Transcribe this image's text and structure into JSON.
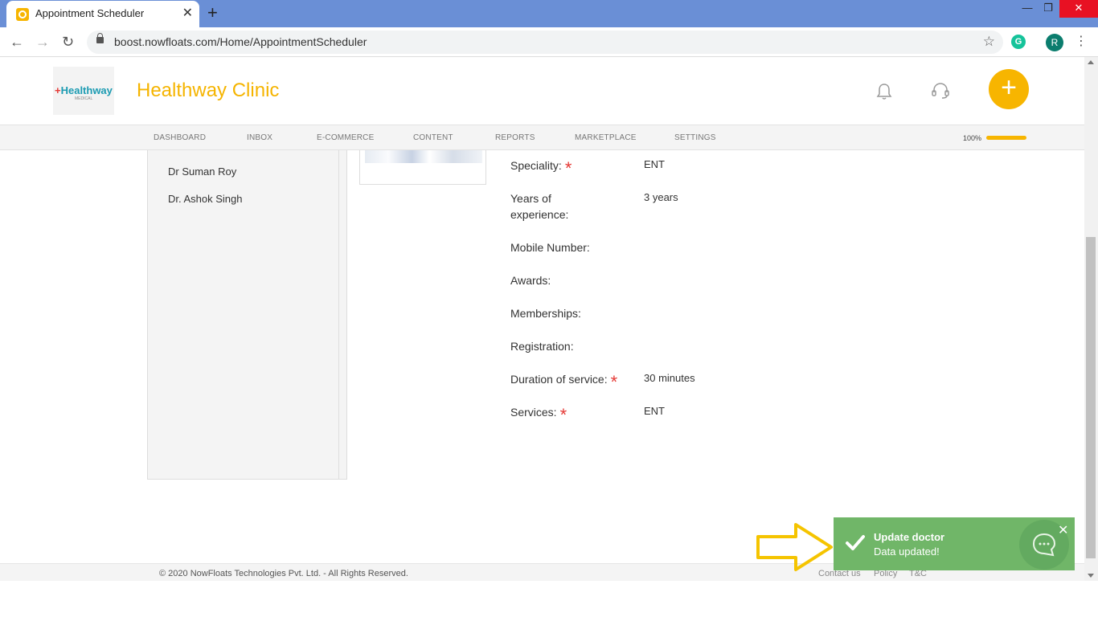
{
  "browser": {
    "tab_title": "Appointment Scheduler",
    "tab_close": "✕",
    "new_tab": "+",
    "url": "boost.nowfloats.com/Home/AppointmentScheduler",
    "back": "←",
    "forward": "→",
    "reload": "↻",
    "star": "☆",
    "extension_letter": "G",
    "profile_initial": "R",
    "menu": "⋮",
    "win_min": "—",
    "win_max": "❐",
    "win_close": "✕"
  },
  "header": {
    "logo_plus": "+",
    "logo_text": "Healthway",
    "logo_sub": "MEDICAL",
    "clinic_name": "Healthway Clinic",
    "fab_label": "+"
  },
  "nav": {
    "items": [
      "DASHBOARD",
      "INBOX",
      "E-COMMERCE",
      "CONTENT",
      "REPORTS",
      "MARKETPLACE",
      "SETTINGS"
    ],
    "progress_label": "100%",
    "progress_value": 1.0
  },
  "doctors": [
    "Dr Suman Roy",
    "Dr. Ashok Singh"
  ],
  "details": [
    {
      "label": "Speciality:",
      "value": "ENT",
      "required": true
    },
    {
      "label": "Years of experience:",
      "value": "3 years",
      "required": false
    },
    {
      "label": "Mobile Number:",
      "value": "",
      "required": false
    },
    {
      "label": "Awards:",
      "value": "",
      "required": false
    },
    {
      "label": "Memberships:",
      "value": "",
      "required": false
    },
    {
      "label": "Registration:",
      "value": "",
      "required": false
    },
    {
      "label": "Duration of service:",
      "value": "30 minutes",
      "required": true
    },
    {
      "label": "Services:",
      "value": "ENT",
      "required": true
    }
  ],
  "required_mark": "*",
  "footer": {
    "copyright": "© 2020 NowFloats Technologies Pvt. Ltd. - All Rights Reserved.",
    "links": [
      "Contact us",
      "Policy",
      "T&C"
    ]
  },
  "toast": {
    "title": "Update doctor",
    "message": "Data updated!",
    "close": "✕"
  },
  "colors": {
    "brand": "#f7b500",
    "toast_bg": "#70b668",
    "required": "#e53935",
    "annotation_arrow": "#f5c400"
  }
}
